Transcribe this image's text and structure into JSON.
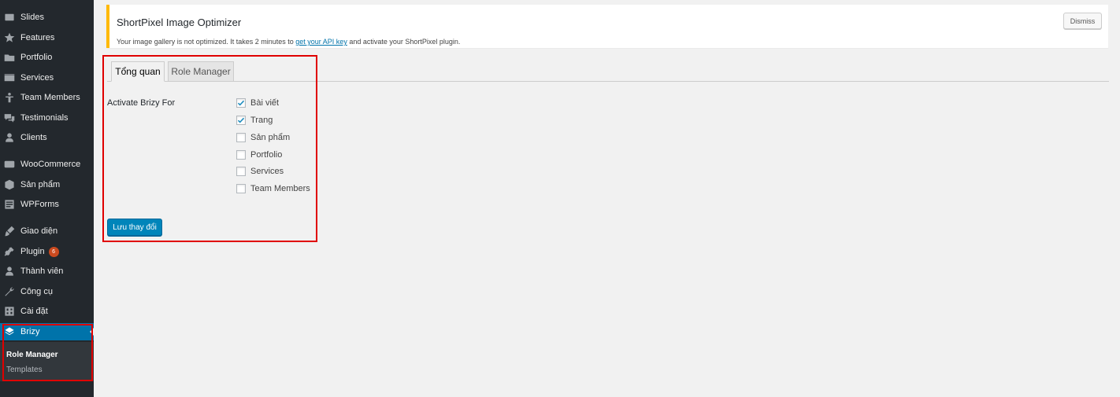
{
  "sidebar": {
    "items": [
      {
        "label": "Slides",
        "icon": "slides-icon"
      },
      {
        "label": "Features",
        "icon": "star-icon"
      },
      {
        "label": "Portfolio",
        "icon": "folder-icon"
      },
      {
        "label": "Services",
        "icon": "services-icon"
      },
      {
        "label": "Team Members",
        "icon": "person-icon"
      },
      {
        "label": "Testimonials",
        "icon": "comments-icon"
      },
      {
        "label": "Clients",
        "icon": "user-icon"
      },
      {
        "label": "WooCommerce",
        "icon": "woo-icon"
      },
      {
        "label": "Sản phẩm",
        "icon": "cube-icon"
      },
      {
        "label": "WPForms",
        "icon": "forms-icon"
      },
      {
        "label": "Giao diện",
        "icon": "brush-icon"
      },
      {
        "label": "Plugin",
        "icon": "plugin-icon",
        "badge": "6"
      },
      {
        "label": "Thành viên",
        "icon": "user-icon"
      },
      {
        "label": "Công cụ",
        "icon": "wrench-icon"
      },
      {
        "label": "Cài đặt",
        "icon": "settings-icon"
      },
      {
        "label": "Brizy",
        "icon": "brizy-icon"
      }
    ],
    "submenu": [
      {
        "label": "Role Manager"
      },
      {
        "label": "Templates"
      }
    ]
  },
  "notice": {
    "title": "ShortPixel Image Optimizer",
    "text_before": "Your image gallery is not optimized. It takes 2 minutes to ",
    "link": "get your API key",
    "text_after": " and activate your ShortPixel plugin.",
    "dismiss": "Dismiss",
    "accent_color": "#ffb900"
  },
  "tabs": [
    {
      "label": "Tổng quan",
      "active": true
    },
    {
      "label": "Role Manager",
      "active": false
    }
  ],
  "form": {
    "label": "Activate Brizy For",
    "options": [
      {
        "label": "Bài viết",
        "checked": true
      },
      {
        "label": "Trang",
        "checked": true
      },
      {
        "label": "Sản phẩm",
        "checked": false
      },
      {
        "label": "Portfolio",
        "checked": false
      },
      {
        "label": "Services",
        "checked": false
      },
      {
        "label": "Team Members",
        "checked": false
      }
    ],
    "save_button": "Lưu thay đổi"
  },
  "colors": {
    "sidebar_bg": "#23282d",
    "active_menu": "#0073aa",
    "primary_button": "#0085ba",
    "highlight": "#e00000"
  }
}
